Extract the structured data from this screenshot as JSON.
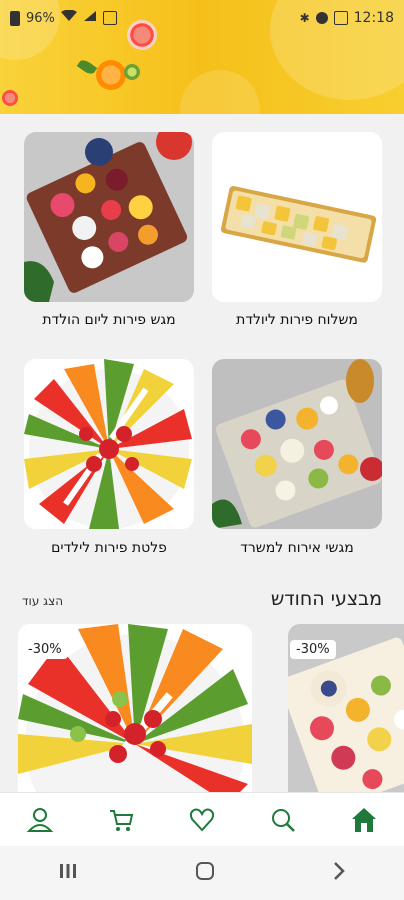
{
  "status_bar": {
    "battery": "96%",
    "time": "12:18"
  },
  "categories": [
    {
      "label": "משלוח פירות ליולדת",
      "image": "fruit-tray-wrapped"
    },
    {
      "label": "מגש פירות ליום הולדת",
      "image": "birthday-fruit-platter"
    },
    {
      "label": "מגשי אירוח למשרד",
      "image": "office-hosting-platter"
    },
    {
      "label": "פלטת פירות לילדים",
      "image": "kids-vegetable-platter"
    }
  ],
  "deals_section": {
    "title": "מבצעי החודש",
    "more_link": "הצג עוד"
  },
  "deals": [
    {
      "discount": "-30%",
      "image": "vegetable-platter"
    },
    {
      "discount": "-30%",
      "image": "fruit-platter"
    }
  ],
  "bottom_nav": {
    "items": [
      "profile-icon",
      "cart-icon",
      "heart-icon",
      "search-icon",
      "home-icon"
    ],
    "active_color": "#1e7a3a"
  }
}
